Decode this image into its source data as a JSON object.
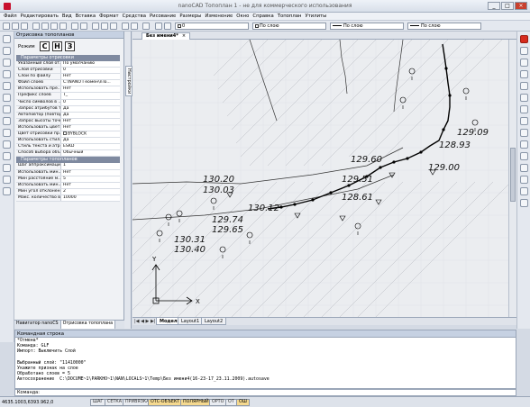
{
  "app": {
    "title": "nanoCAD Топоплан 1 - не для коммерческого использования"
  },
  "menu": [
    "Файл",
    "Редактировать",
    "Вид",
    "Вставка",
    "Формат",
    "Средства",
    "Рисование",
    "Размеры",
    "Изменение",
    "Окно",
    "Справка",
    "Топоплан",
    "Утилиты"
  ],
  "layer_bar": {
    "layer": "0",
    "linetype1": "По слою",
    "linetype2": "По слою",
    "lineweight": "По слою"
  },
  "panel": {
    "title": "Отрисовка топопланов",
    "mode_label": "Режим",
    "mode_buttons": [
      "С",
      "Н",
      "З"
    ],
    "side_tab": "Настройки",
    "section1": "Параметры отрисовки",
    "rows1": [
      {
        "k": "Указанный слой от...",
        "v": "По умолчанию"
      },
      {
        "k": "Слой отрисовки",
        "v": "0"
      },
      {
        "k": "Слои по файлу",
        "v": "Нет"
      },
      {
        "k": "Файл слоев",
        "v": "C:\\NANO Геомен\\nTo..."
      },
      {
        "k": "Использовать пре...",
        "v": "Нет"
      },
      {
        "k": "Префикс слоев",
        "v": "T_"
      },
      {
        "k": "Число символов в ...",
        "v": "0"
      },
      {
        "k": "Запрос атрибутов т...",
        "v": "Да"
      },
      {
        "k": "Автоповтор (повтор...",
        "v": "Да"
      },
      {
        "k": "Запрос высоты точки",
        "v": "Нет"
      },
      {
        "k": "Использовать цвет...",
        "v": "Нет"
      },
      {
        "k": "Цвет отрисовки пр...",
        "v": "BYBLOCK"
      },
      {
        "k": "Использовать стил...",
        "v": "Да"
      },
      {
        "k": "Стиль текста и атр...",
        "v": "ESKD"
      },
      {
        "k": "Способ выбора объ...",
        "v": "Обычный"
      }
    ],
    "section2": "Параметры топопланов",
    "rows2": [
      {
        "k": "Шаг аппроксимации",
        "v": "1"
      },
      {
        "k": "Использовать мин...",
        "v": "Нет"
      },
      {
        "k": "Мин расстояние м...",
        "v": "5"
      },
      {
        "k": "Использовать мин...",
        "v": "Нет"
      },
      {
        "k": "Мин угол отклонен...",
        "v": "2"
      },
      {
        "k": "Макс. количество в...",
        "v": "10000"
      }
    ],
    "tabs": [
      "Навигатор nanoCS",
      "Отрисовка топоплана"
    ]
  },
  "drawing": {
    "tab": "Без имени4*",
    "close": "×",
    "layout_nav": "|◀ ◀ ▶ ▶|",
    "layouts": [
      "Модель",
      "Layout1",
      "Layout2"
    ]
  },
  "labels": [
    "129.09",
    "128.93",
    "129.00",
    "129.60",
    "129.51",
    "128.61",
    "130.20",
    "130.03",
    "130.12",
    "129.74",
    "129.65",
    "130.31",
    "130.40"
  ],
  "axes": {
    "y": "Y",
    "x": "X"
  },
  "command": {
    "title": "Командная строка",
    "lines": [
      "*Отмена*",
      "Команда: GLF",
      "Импорт: Выключить Слой",
      "",
      "Выбранный слой: \"11410000\"",
      "Укажите признак на слое",
      "Обработано слоев = 5",
      "Автосохранение  C:\\DOCUME~1\\PARKHO~1\\NAN\\LOCALS~1\\Temp\\Без имени4(16-23-17_23.11.2009).autosave"
    ],
    "prompt": "Команда:"
  },
  "status": {
    "coords": "4635.1003,6393.962,0",
    "buttons": [
      "ШАГ",
      "СЕТКА",
      "ПРИВЯЗКА",
      "ОТС-ОБЪЕКТ",
      "ПОЛЯРНЫЙ",
      "ОРТО",
      "ОТ",
      "ОШ"
    ]
  }
}
